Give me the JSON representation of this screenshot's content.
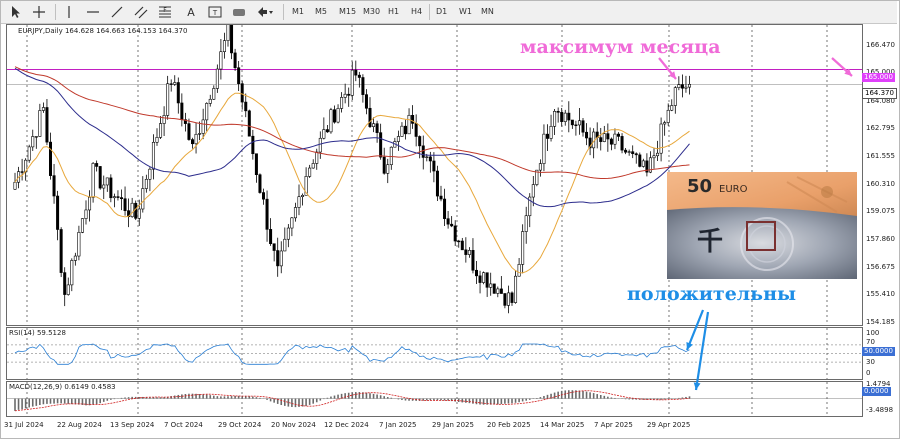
{
  "toolbar": {
    "icons": [
      "cursor-icon",
      "crosshair-icon",
      "vertical-line-icon",
      "horizontal-line-icon",
      "trend-line-icon",
      "channel-icon",
      "fibonacci-icon",
      "text-icon",
      "label-icon",
      "shape-icon",
      "arrow-icon"
    ],
    "timeframes": [
      "M1",
      "M5",
      "M15",
      "M30",
      "H1",
      "H4",
      "D1",
      "W1",
      "MN"
    ]
  },
  "chart": {
    "symbol_info": "EURJPY,Daily  164.628 164.663 164.153 164.370",
    "price_labels": [
      "166.470",
      "165.000",
      "164.370",
      "164.080",
      "162.795",
      "161.555",
      "160.310",
      "159.075",
      "157.860",
      "156.675",
      "155.410",
      "154.185"
    ],
    "level_tag": "165.000",
    "current_tag": "164.370",
    "dates": [
      "31 Jul 2024",
      "22 Aug 2024",
      "13 Sep 2024",
      "7 Oct 2024",
      "29 Oct 2024",
      "20 Nov 2024",
      "12 Dec 2024",
      "7 Jan 2025",
      "29 Jan 2025",
      "20 Feb 2025",
      "14 Mar 2025",
      "7 Apr 2025",
      "29 Apr 2025"
    ],
    "colors": {
      "candle": "#000000",
      "level_line": "#c21fc2",
      "ma_fast": "#e8a83c",
      "ma_mid": "#c0392b",
      "ma_slow": "#2c2c8c",
      "arrow_pink": "#f06bd8",
      "arrow_blue": "#1e8ee6",
      "indicator_line": "#2a7fd4",
      "indicator_tag": "#3b6fd4"
    }
  },
  "rsi": {
    "label": "RSI(14) 59.5128",
    "levels": [
      "100",
      "70",
      "50.0000",
      "30",
      "0"
    ],
    "tag": "50.0000"
  },
  "macd": {
    "label": "MACD(12,26,9) 0.6149 0.4583",
    "levels": [
      "1.4794",
      "0.0000",
      "-3.4898"
    ],
    "tag": "0.0000"
  },
  "annotations": {
    "month_max": "максимум месяца",
    "positive": "положительны"
  },
  "photo": {
    "banknote_label": "EURO",
    "banknote_value": "50",
    "yen_char": "千"
  }
}
